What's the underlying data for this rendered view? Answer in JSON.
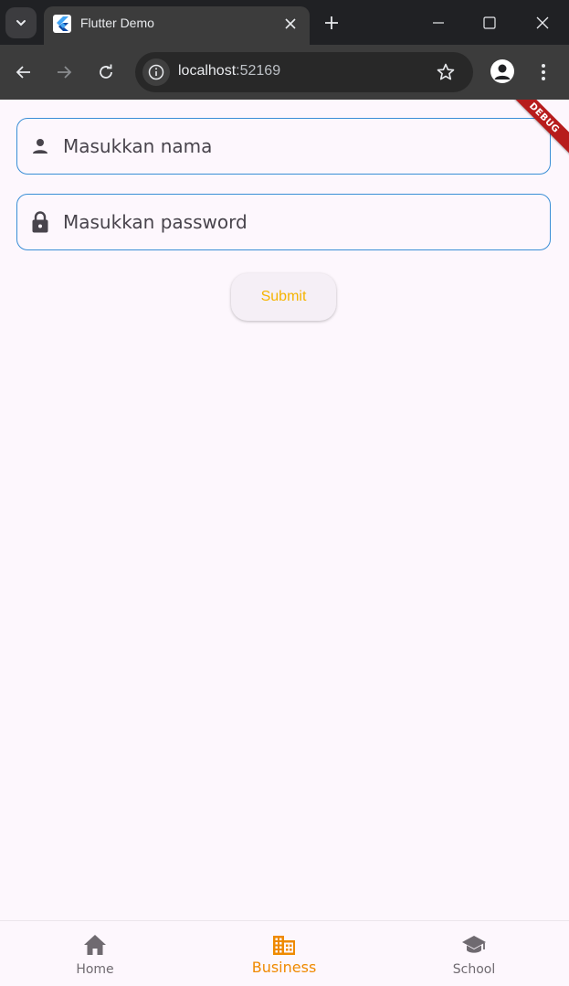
{
  "browser": {
    "tab_title": "Flutter Demo",
    "url_host": "localhost",
    "url_port": ":52169"
  },
  "form": {
    "name_placeholder": "Masukkan nama",
    "password_placeholder": "Masukkan password",
    "submit_label": "Submit"
  },
  "debug_banner": "DEBUG",
  "bottom_nav": {
    "items": [
      {
        "label": "Home",
        "icon": "home-icon",
        "active": false
      },
      {
        "label": "Business",
        "icon": "business-icon",
        "active": true
      },
      {
        "label": "School",
        "icon": "school-icon",
        "active": false
      }
    ]
  },
  "colors": {
    "accent_active": "#ef8a00",
    "submit_text": "#f5b400",
    "field_border": "#3a8fd6",
    "background": "#fdf7fd"
  }
}
